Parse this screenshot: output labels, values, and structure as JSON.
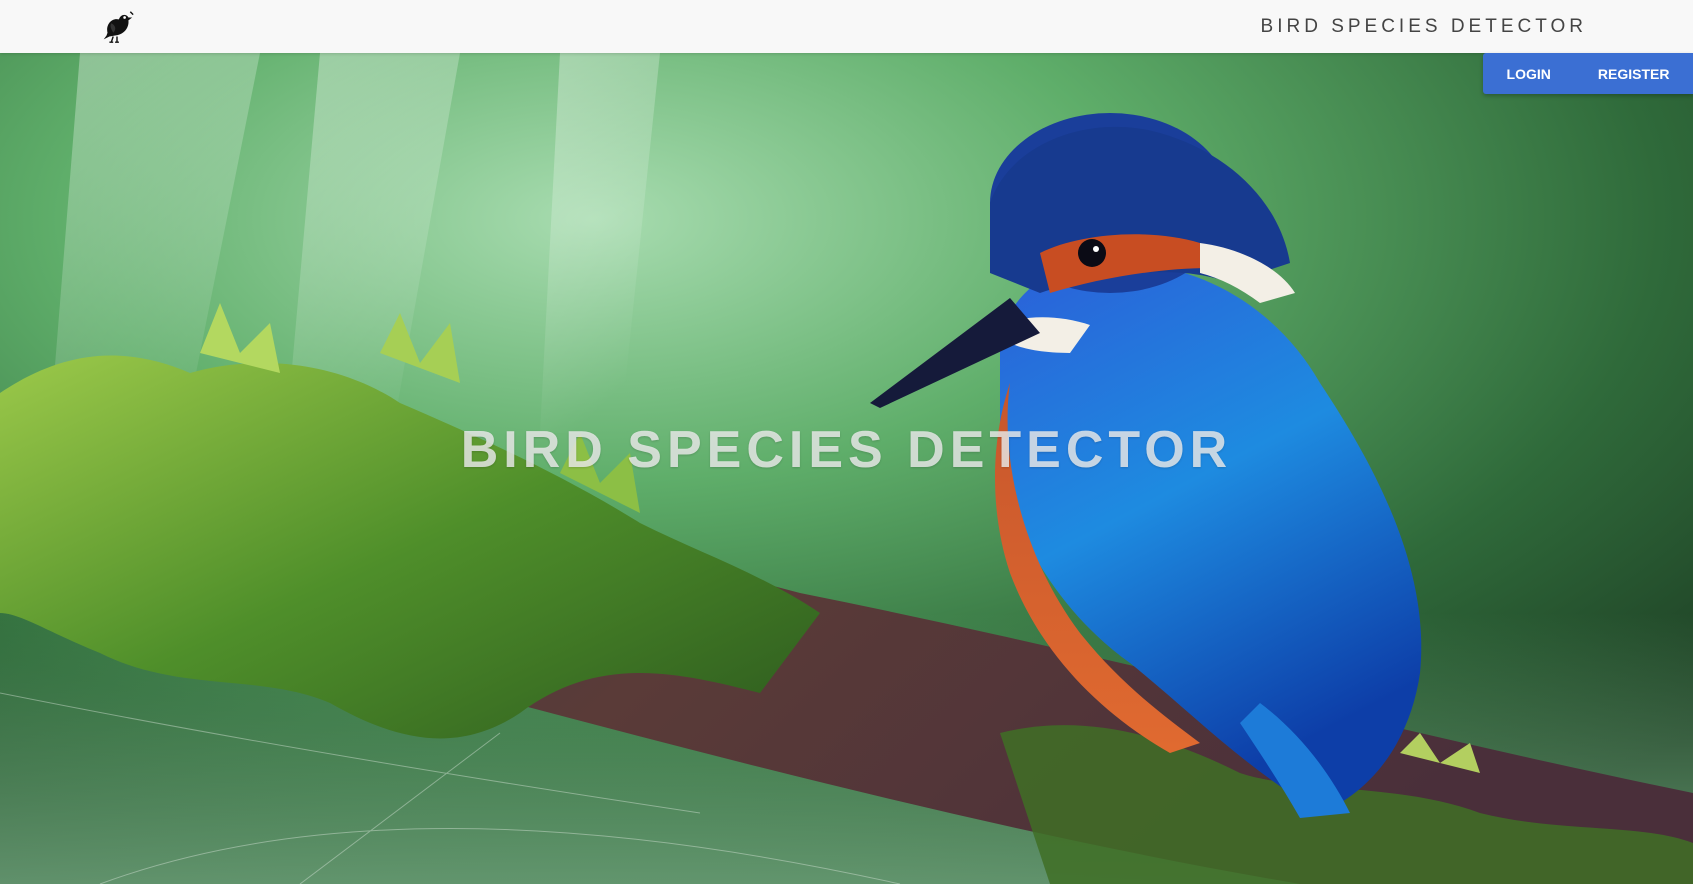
{
  "header": {
    "brand_title": "BIRD SPECIES DETECTOR",
    "logo_icon": "bird-icon"
  },
  "auth": {
    "login_label": "LOGIN",
    "register_label": "REGISTER",
    "accent_color": "#3b6fd3"
  },
  "hero": {
    "title": "BIRD SPECIES DETECTOR",
    "background": "kingfisher-on-mossy-branch-photo"
  }
}
